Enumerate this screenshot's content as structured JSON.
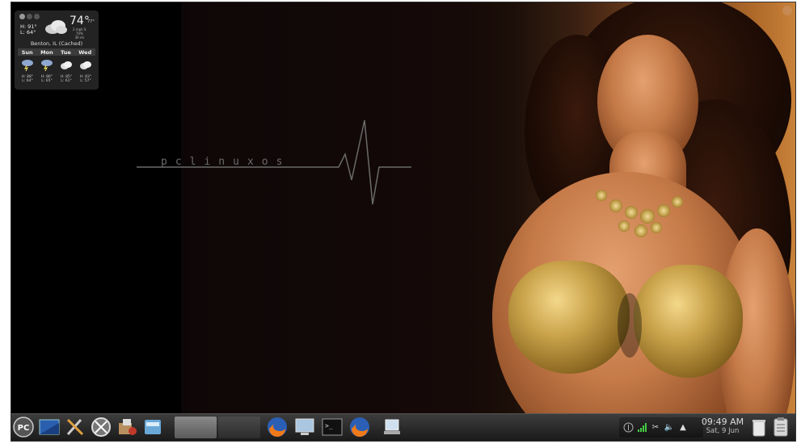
{
  "desktop": {
    "logo_text": "pclinuxos"
  },
  "weather": {
    "current_temp": "74°",
    "current_temp_small": "77°",
    "high": "H: 91°",
    "low": "L: 64°",
    "wind": "2 mph S",
    "humidity": "74%",
    "visibility": "30 mi",
    "location": "Benton, IL (Cached)",
    "days": [
      {
        "name": "Sun",
        "high": "H: 88°",
        "low": "L: 64°",
        "icon": "thunderstorm-icon"
      },
      {
        "name": "Mon",
        "high": "H: 86°",
        "low": "L: 65°",
        "icon": "thunderstorm-icon"
      },
      {
        "name": "Tue",
        "high": "H: 85°",
        "low": "L: 61°",
        "icon": "cloudy-icon"
      },
      {
        "name": "Wed",
        "high": "H: 83°",
        "low": "L: 57°",
        "icon": "cloudy-icon"
      }
    ]
  },
  "taskbar": {
    "launchers": [
      {
        "name": "pclinuxos-menu-icon",
        "label": "PC"
      },
      {
        "name": "desktop-icon"
      },
      {
        "name": "system-tools-icon"
      },
      {
        "name": "control-center-icon"
      },
      {
        "name": "package-manager-icon"
      },
      {
        "name": "file-manager-icon"
      }
    ],
    "tasks": [
      {
        "name": "firefox-icon"
      },
      {
        "name": "remote-desktop-icon"
      },
      {
        "name": "terminal-icon"
      },
      {
        "name": "firefox-icon"
      },
      {
        "name": "screenshot-icon"
      }
    ],
    "tray": {
      "icons": [
        "update-icon",
        "network-signal-icon",
        "clipboard-icon",
        "volume-icon",
        "notification-arrow-icon"
      ]
    },
    "clock": {
      "time": "09:49 AM",
      "date": "Sat, 9 Jun"
    },
    "trash_icon": "trash-icon",
    "clipboard_icon": "clipboard-klipper-icon"
  },
  "colors": {
    "taskbar_bg": "#2a2a2a",
    "wallpaper_warm": "#b06a2a"
  }
}
